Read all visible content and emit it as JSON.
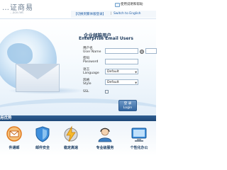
{
  "header": {
    "logo_text": "…证商易",
    "logo_subtext": "…ace.net",
    "help_link": "使用说明和帮助",
    "link_1": "【切换到繁体版登录】",
    "link_separator": "|",
    "link_2": "Switch to English"
  },
  "login": {
    "title_zh": "企业邮箱用户",
    "title_en": "Enterprise Email Users",
    "username_label_zh": "用户名",
    "username_label_en": "User Name",
    "username_value": "",
    "at_symbol": "@",
    "domain_value": "",
    "password_label_zh": "密码",
    "password_label_en": "Password",
    "password_value": "",
    "language_label_zh": "语言",
    "language_label_en": "Language",
    "language_value": "Default",
    "style_label_zh": "风格",
    "style_label_en": "Style",
    "style_value": "Default",
    "ssl_label": "SSL",
    "ssl_checked": false,
    "button_zh": "登 录",
    "button_en": "Login"
  },
  "section": {
    "label": "用优势"
  },
  "features": [
    {
      "label": "件通邮",
      "icon": "mail-network-icon",
      "color": "#e07a1f"
    },
    {
      "label": "邮件安全",
      "icon": "shield-icon",
      "color": "#2e78c7"
    },
    {
      "label": "稳定高速",
      "icon": "lightning-icon",
      "color": "#f0a21c"
    },
    {
      "label": "专业级服务",
      "icon": "support-agent-icon",
      "color": "#3c7fc4"
    },
    {
      "label": "个性化办公",
      "icon": "monitor-icon",
      "color": "#3a8edc"
    }
  ],
  "colors": {
    "brand_blue": "#1c4676",
    "link_blue": "#1b5aa4",
    "button_blue": "#3467a1"
  }
}
